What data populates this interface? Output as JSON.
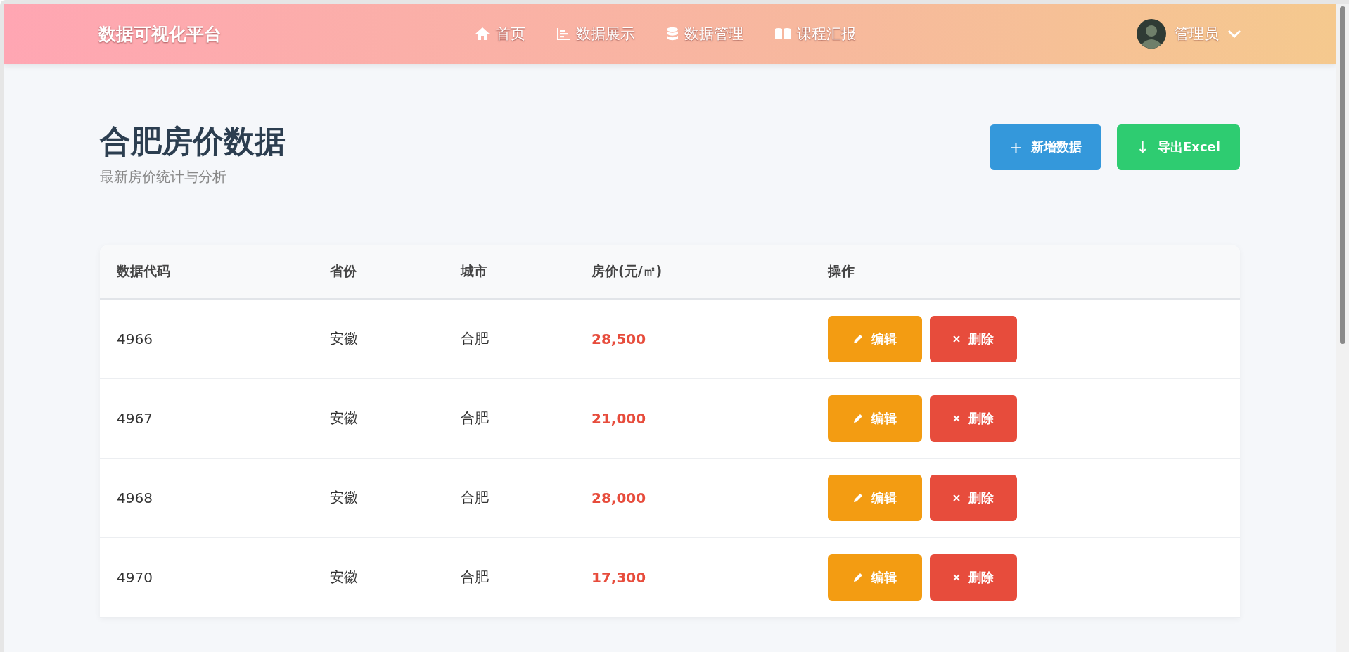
{
  "navbar": {
    "brand": "数据可视化平台",
    "links": [
      {
        "label": "首页"
      },
      {
        "label": "数据展示"
      },
      {
        "label": "数据管理"
      },
      {
        "label": "课程汇报"
      }
    ],
    "user": {
      "name": "管理员"
    }
  },
  "page": {
    "title": "合肥房价数据",
    "subtitle": "最新房价统计与分析",
    "buttons": [
      {
        "label": "新增数据",
        "symbol": "+",
        "kind": "add"
      },
      {
        "label": "导出Excel",
        "symbol": "↓",
        "kind": "export"
      }
    ]
  },
  "table": {
    "columns": [
      "数据代码",
      "省份",
      "城市",
      "房价(元/㎡)",
      "操作"
    ],
    "rows": [
      {
        "code": "4966",
        "province": "安徽",
        "city": "合肥",
        "price": "28,500",
        "actions": [
          {
            "label": "编辑",
            "kind": "edit"
          },
          {
            "label": "删除",
            "kind": "delete"
          }
        ]
      },
      {
        "code": "4967",
        "province": "安徽",
        "city": "合肥",
        "price": "21,000",
        "actions": [
          {
            "label": "编辑",
            "kind": "edit"
          },
          {
            "label": "删除",
            "kind": "delete"
          }
        ]
      },
      {
        "code": "4968",
        "province": "安徽",
        "city": "合肥",
        "price": "28,000",
        "actions": [
          {
            "label": "编辑",
            "kind": "edit"
          },
          {
            "label": "删除",
            "kind": "delete"
          }
        ]
      },
      {
        "code": "4970",
        "province": "安徽",
        "city": "合肥",
        "price": "17,300",
        "actions": [
          {
            "label": "编辑",
            "kind": "edit"
          },
          {
            "label": "删除",
            "kind": "delete"
          }
        ]
      }
    ]
  }
}
